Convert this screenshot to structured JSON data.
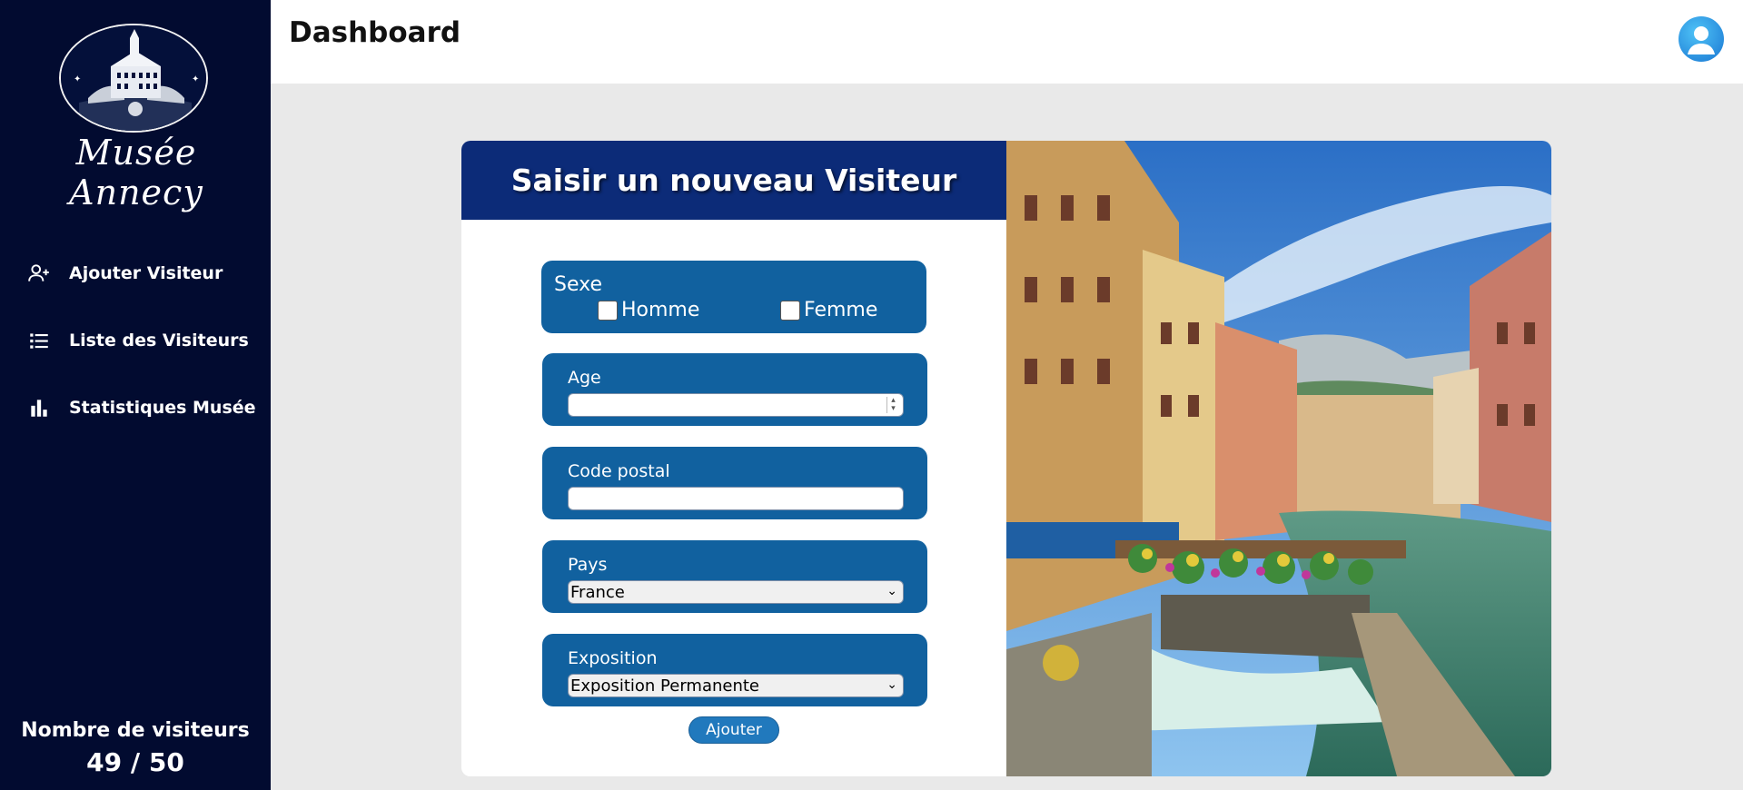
{
  "sidebar": {
    "logo_text": "Musée Annecy",
    "nav": [
      {
        "label": "Ajouter Visiteur",
        "icon": "add-user-icon"
      },
      {
        "label": "Liste des Visiteurs",
        "icon": "list-icon"
      },
      {
        "label": "Statistiques Musée",
        "icon": "bar-chart-icon"
      }
    ],
    "visitor_count": {
      "label": "Nombre de visiteurs",
      "value": "49 / 50"
    }
  },
  "header": {
    "title": "Dashboard",
    "avatar_icon": "user-avatar-icon"
  },
  "form": {
    "title": "Saisir un nouveau Visiteur",
    "sexe": {
      "label": "Sexe",
      "options": [
        "Homme",
        "Femme"
      ]
    },
    "age": {
      "label": "Age",
      "value": ""
    },
    "code_postal": {
      "label": "Code postal",
      "value": ""
    },
    "pays": {
      "label": "Pays",
      "selected": "France"
    },
    "exposition": {
      "label": "Exposition",
      "selected": "Exposition Permanente"
    },
    "submit_label": "Ajouter"
  },
  "colors": {
    "sidebar_bg": "#020b30",
    "form_header_bg": "#0c2b78",
    "field_bg": "#11619f",
    "button_bg": "#2179bd"
  }
}
